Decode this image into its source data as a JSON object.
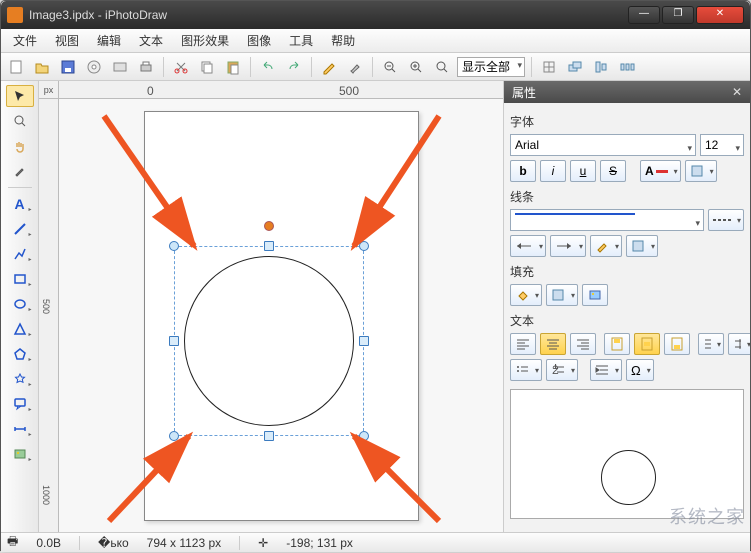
{
  "window": {
    "title": "Image3.ipdx - iPhotoDraw"
  },
  "menu": {
    "items": [
      "文件",
      "视图",
      "编辑",
      "文本",
      "图形效果",
      "图像",
      "工具",
      "帮助"
    ]
  },
  "toolbar": {
    "zoom_label": "显示全部"
  },
  "ruler": {
    "unit": "px",
    "h0": "0",
    "h500": "500",
    "v500": "500",
    "v1000": "1000"
  },
  "props": {
    "title": "属性",
    "font_section": "字体",
    "font_name": "Arial",
    "font_size": "12",
    "bold": "b",
    "italic": "i",
    "underline": "u",
    "strike": "S",
    "line_section": "线条",
    "fill_section": "填充",
    "text_section": "文本"
  },
  "status": {
    "filesize": "0.0B",
    "dimensions": "794 x 1123 px",
    "cursor": "-198; 131 px"
  }
}
